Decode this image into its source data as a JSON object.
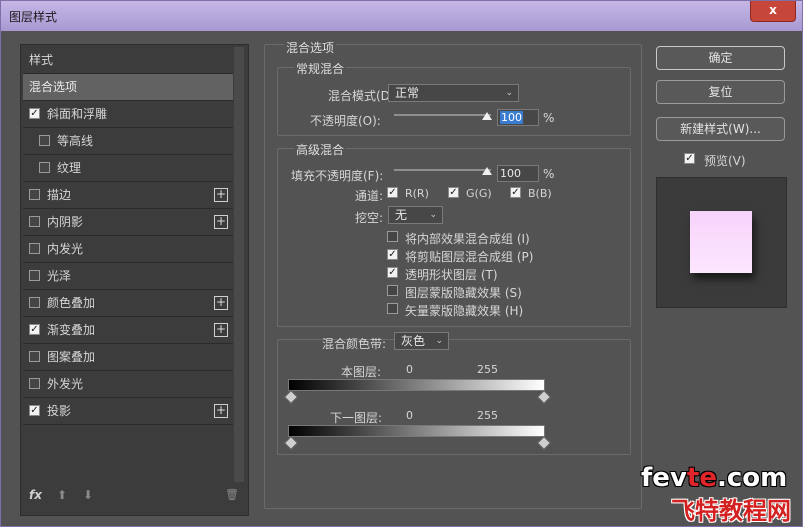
{
  "window": {
    "title": "图层样式",
    "close_glyph": "x"
  },
  "sidebar": {
    "header": "样式",
    "items": [
      {
        "label": "混合选项",
        "selected": true
      },
      {
        "label": "斜面和浮雕",
        "checked": true
      },
      {
        "label": "等高线",
        "checked": false,
        "sub": true
      },
      {
        "label": "纹理",
        "checked": false,
        "sub": true
      },
      {
        "label": "描边",
        "checked": false,
        "plus": true
      },
      {
        "label": "内阴影",
        "checked": false,
        "plus": true
      },
      {
        "label": "内发光",
        "checked": false
      },
      {
        "label": "光泽",
        "checked": false
      },
      {
        "label": "颜色叠加",
        "checked": false,
        "plus": true
      },
      {
        "label": "渐变叠加",
        "checked": true,
        "plus": true
      },
      {
        "label": "图案叠加",
        "checked": false
      },
      {
        "label": "外发光",
        "checked": false
      },
      {
        "label": "投影",
        "checked": true,
        "plus": true
      }
    ],
    "footer": {
      "fx": "fx",
      "up": "⬆",
      "down": "⬇",
      "trash": "🗑"
    }
  },
  "blend": {
    "section_title": "混合选项",
    "general": {
      "title": "常规混合",
      "mode_label": "混合模式(D):",
      "mode_value": "正常",
      "opacity_label": "不透明度(O):",
      "opacity_value": "100",
      "percent": "%"
    },
    "advanced": {
      "title": "高级混合",
      "fill_label": "填充不透明度(F):",
      "fill_value": "100",
      "percent": "%",
      "channels_label": "通道:",
      "channel_r": "R(R)",
      "channel_g": "G(G)",
      "channel_b": "B(B)",
      "knockout_label": "挖空:",
      "knockout_value": "无",
      "options": [
        {
          "label": "将内部效果混合成组 (I)",
          "checked": false
        },
        {
          "label": "将剪贴图层混合成组 (P)",
          "checked": true
        },
        {
          "label": "透明形状图层 (T)",
          "checked": true
        },
        {
          "label": "图层蒙版隐藏效果 (S)",
          "checked": false
        },
        {
          "label": "矢量蒙版隐藏效果 (H)",
          "checked": false
        }
      ]
    },
    "band": {
      "label": "混合颜色带:",
      "value": "灰色",
      "this_layer": "本图层:",
      "this_min": "0",
      "this_max": "255",
      "under_layer": "下一图层:",
      "under_min": "0",
      "under_max": "255"
    }
  },
  "buttons": {
    "ok": "确定",
    "reset": "复位",
    "new_style": "新建样式(W)...",
    "preview": "预览(V)"
  },
  "watermark": {
    "line1_a": "fev",
    "line1_b": "te",
    "line1_c": ".com",
    "line2": "飞特教程网"
  }
}
